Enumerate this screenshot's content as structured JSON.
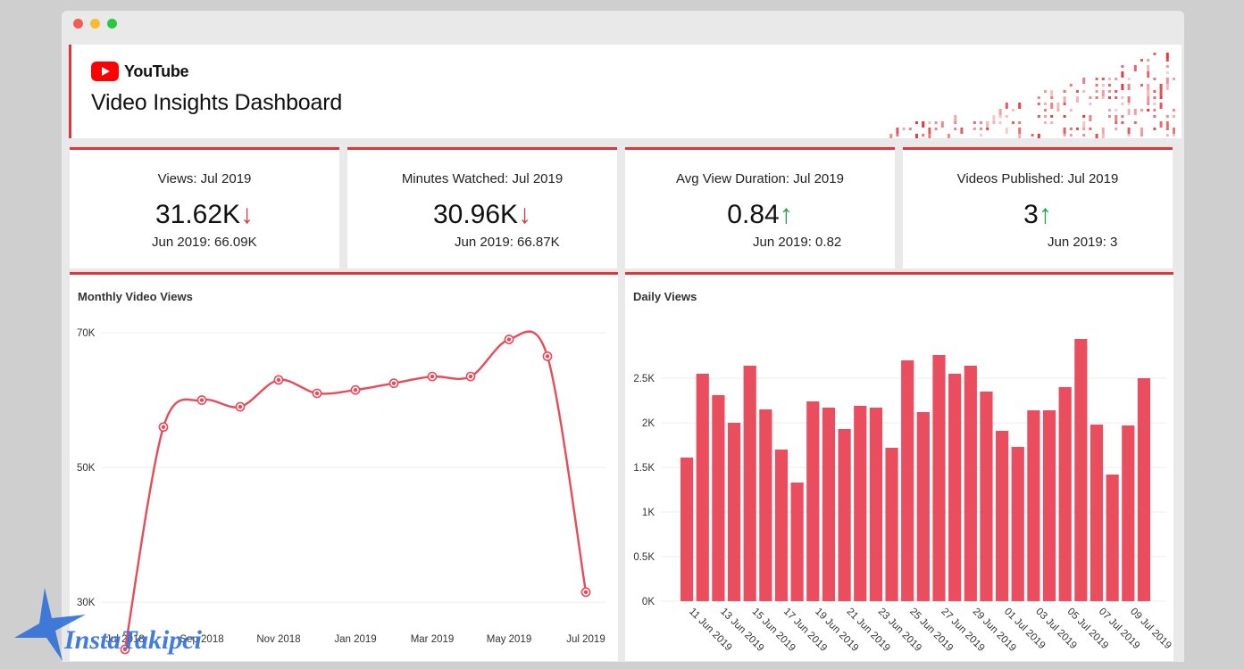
{
  "brand": {
    "name": "YouTube"
  },
  "page_title": "Video Insights Dashboard",
  "colors": {
    "accent": "#e0353b",
    "bar": "#ea4d5e",
    "up": "#1aa34a",
    "down": "#e0353b"
  },
  "kpis": [
    {
      "label": "Views: Jul 2019",
      "value": "31.62K",
      "trend": "↓",
      "comparison": "Jun 2019: 66.09K"
    },
    {
      "label": "Minutes Watched: Jul 2019",
      "value": "30.96K",
      "trend": "↓",
      "comparison": "Jun 2019: 66.87K"
    },
    {
      "label": "Avg View Duration: Jul 2019",
      "value": "0.84",
      "trend": "↑",
      "comparison": "Jun 2019: 0.82"
    },
    {
      "label": "Videos Published: Jul 2019",
      "value": "3",
      "trend": "↑",
      "comparison": "Jun 2019: 3"
    }
  ],
  "watermark": {
    "text": "InstaTakipci"
  },
  "chart_data": [
    {
      "type": "line",
      "title": "Monthly Video Views",
      "x": [
        "Jul 2018",
        "Aug 2018",
        "Sep 2018",
        "Oct 2018",
        "Nov 2018",
        "Dec 2018",
        "Jan 2019",
        "Feb 2019",
        "Mar 2019",
        "Apr 2019",
        "May 2019",
        "Jun 2019",
        "Jul 2019"
      ],
      "x_tick_labels": [
        "Jul 2018",
        "Sep 2018",
        "Nov 2018",
        "Jan 2019",
        "Mar 2019",
        "May 2019",
        "Jul 2019"
      ],
      "values": [
        23000,
        56000,
        60000,
        59000,
        63000,
        61000,
        61500,
        62500,
        63500,
        63500,
        69000,
        66500,
        31500
      ],
      "yticks": [
        30000,
        50000,
        70000
      ],
      "ytick_labels": [
        "30K",
        "50K",
        "70K"
      ],
      "ylim": [
        23000,
        70000
      ],
      "grid": true
    },
    {
      "type": "bar",
      "title": "Daily Views",
      "categories": [
        "11 Jun 2019",
        "12 Jun 2019",
        "13 Jun 2019",
        "14 Jun 2019",
        "15 Jun 2019",
        "16 Jun 2019",
        "17 Jun 2019",
        "18 Jun 2019",
        "19 Jun 2019",
        "20 Jun 2019",
        "21 Jun 2019",
        "22 Jun 2019",
        "23 Jun 2019",
        "24 Jun 2019",
        "25 Jun 2019",
        "26 Jun 2019",
        "27 Jun 2019",
        "28 Jun 2019",
        "29 Jun 2019",
        "30 Jun 2019",
        "01 Jul 2019",
        "02 Jul 2019",
        "03 Jul 2019",
        "04 Jul 2019",
        "05 Jul 2019",
        "06 Jul 2019",
        "07 Jul 2019",
        "08 Jul 2019",
        "09 Jul 2019",
        "10 Jul 2019"
      ],
      "tick_labels": [
        "11 Jun 2019",
        "13 Jun 2019",
        "15 Jun 2019",
        "17 Jun 2019",
        "19 Jun 2019",
        "21 Jun 2019",
        "23 Jun 2019",
        "25 Jun 2019",
        "27 Jun 2019",
        "29 Jun 2019",
        "01 Jul 2019",
        "03 Jul 2019",
        "05 Jul 2019",
        "07 Jul 2019",
        "09 Jul 2019"
      ],
      "values": [
        1610,
        2550,
        2310,
        2000,
        2640,
        2150,
        1700,
        1330,
        2240,
        2170,
        1930,
        2190,
        2170,
        1720,
        2700,
        2120,
        2760,
        2550,
        2640,
        2350,
        1910,
        1730,
        2140,
        2140,
        2400,
        2940,
        1980,
        1420,
        1970,
        2500
      ],
      "yticks": [
        0,
        500,
        1000,
        1500,
        2000,
        2500
      ],
      "ytick_labels": [
        "0K",
        "0.5K",
        "1K",
        "1.5K",
        "2K",
        "2.5K"
      ],
      "ylim": [
        0,
        3000
      ],
      "grid": true
    }
  ]
}
